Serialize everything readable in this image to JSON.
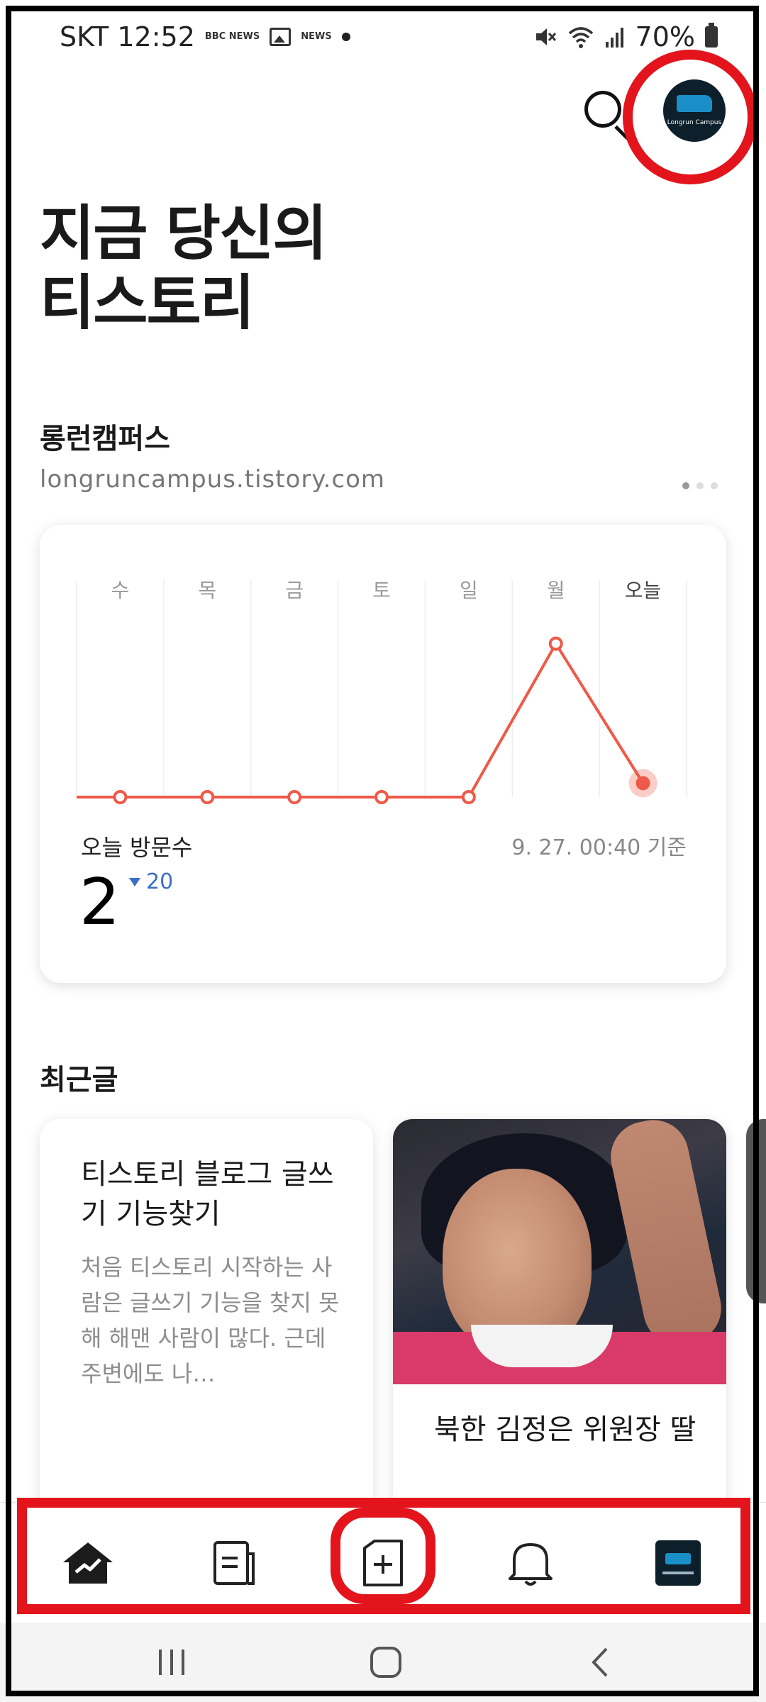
{
  "status_bar": {
    "carrier_time": "SKT 12:52",
    "news_badge_1": "BBC NEWS",
    "news_badge_2": "NEWS",
    "battery": "70%"
  },
  "header": {
    "search_icon": "search-icon",
    "profile_logo_text": "Longrun Campus"
  },
  "page": {
    "title_line1": "지금 당신의",
    "title_line2": "티스토리"
  },
  "blog": {
    "name": "롱런캠퍼스",
    "url": "longruncampus.tistory.com",
    "pager_count": 3,
    "pager_active": 0
  },
  "stats": {
    "days": [
      "수",
      "목",
      "금",
      "토",
      "일",
      "월",
      "오늘"
    ],
    "visit_label": "오늘 방문수",
    "as_of": "9. 27. 00:40 기준",
    "today_count": "2",
    "delta": "20",
    "accent_color": "#ee5a47"
  },
  "chart_data": {
    "type": "line",
    "categories": [
      "수",
      "목",
      "금",
      "토",
      "일",
      "월",
      "오늘"
    ],
    "values": [
      0,
      0,
      0,
      0,
      0,
      22,
      2
    ],
    "ylim": [
      0,
      24
    ],
    "grid": true
  },
  "recent": {
    "title": "최근글",
    "posts": [
      {
        "title": "티스토리 블로그 글쓰기 기능찾기",
        "excerpt": "처음 티스토리 시작하는 사람은 글쓰기 기능을 찾지 못해 해맨 사람이 많다. 근데 주변에도 나…"
      },
      {
        "title": "북한 김정은 위원장 딸"
      }
    ]
  },
  "bottom_nav": {
    "items": [
      "stats-home-icon",
      "posts-icon",
      "write-post-icon",
      "notification-bell-icon",
      "profile-blog-icon"
    ]
  },
  "system_nav": {
    "items": [
      "recent-apps-icon",
      "home-icon",
      "back-icon"
    ]
  },
  "colors": {
    "annotation_red": "#e3141c",
    "chart_line": "#ee5a47",
    "delta_blue": "#3a6fc6"
  }
}
